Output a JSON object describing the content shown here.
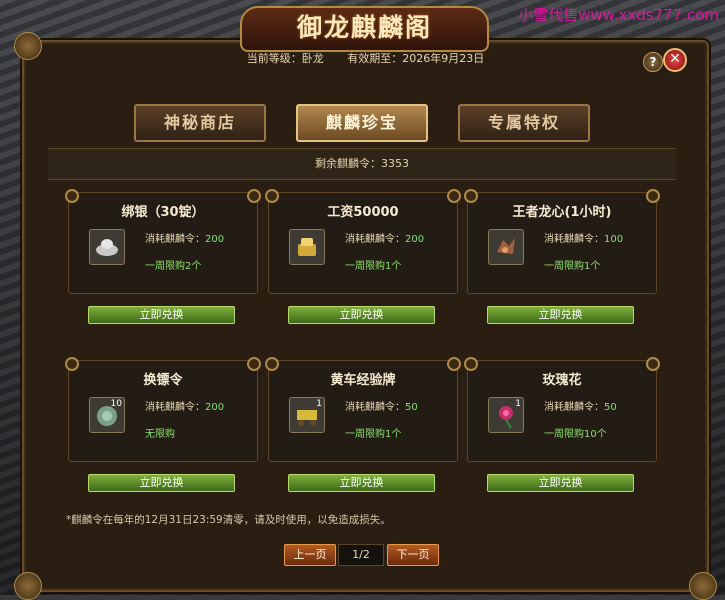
{
  "watermark": "小雪代售www.xxds777.com",
  "title": "御龙麒麟阁",
  "info": {
    "level_label": "当前等级：卧龙",
    "valid_label": "有效期至：2026年9月23日"
  },
  "help_label": "?",
  "close_label": "✕",
  "tabs": [
    {
      "label": "神秘商店",
      "active": false
    },
    {
      "label": "麒麟珍宝",
      "active": true
    },
    {
      "label": "专属特权",
      "active": false
    }
  ],
  "remaining": "剩余麒麟令：3353",
  "cost_prefix": "消耗麒麟令：",
  "exchange_label": "立即兑换",
  "items": [
    {
      "name": "绑银（30锭）",
      "cost": "200",
      "limit": "一周限购2个",
      "icon": "silver-ingot-icon",
      "qty": "",
      "color": "#c8c8c8"
    },
    {
      "name": "工资50000",
      "cost": "200",
      "limit": "一周限购1个",
      "icon": "gold-treasure-icon",
      "qty": "",
      "color": "#d4a83a"
    },
    {
      "name": "王者龙心(1小时)",
      "cost": "100",
      "limit": "一周限购1个",
      "icon": "dragon-heart-icon",
      "qty": "",
      "color": "#a06040"
    },
    {
      "name": "换镖令",
      "cost": "200",
      "limit": "无限购",
      "icon": "escort-token-icon",
      "qty": "10",
      "color": "#7aa088"
    },
    {
      "name": "黄车经验牌",
      "cost": "50",
      "limit": "一周限购1个",
      "icon": "yellow-cart-icon",
      "qty": "1",
      "color": "#d8b838"
    },
    {
      "name": "玫瑰花",
      "cost": "50",
      "limit": "一周限购10个",
      "icon": "rose-icon",
      "qty": "1",
      "color": "#c0306a"
    }
  ],
  "note": "*麒麟令在每年的12月31日23:59清零，请及时使用，以免造成损失。",
  "pager": {
    "prev": "上一页",
    "page": "1/2",
    "next": "下一页"
  }
}
